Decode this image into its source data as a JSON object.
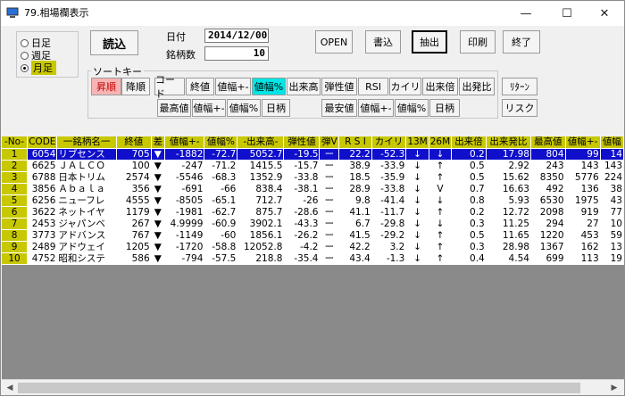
{
  "window": {
    "title": "79.相場欄表示",
    "minimize_glyph": "—",
    "maximize_glyph": "☐",
    "close_glyph": "✕"
  },
  "period": {
    "options": [
      "日足",
      "週足",
      "月足"
    ],
    "selected": "月足"
  },
  "buttons": {
    "load": "読込",
    "open": "OPEN",
    "write": "書込",
    "extract": "抽出",
    "print": "印刷",
    "exit": "終了"
  },
  "info": {
    "date_label": "日付",
    "date_value": "2014/12/00",
    "count_label": "銘柄数",
    "count_value": "10"
  },
  "sort": {
    "title": "ソートキー",
    "row1": [
      "昇順",
      "降順",
      "コード",
      "終値",
      "値幅+-",
      "値幅%",
      "出来高",
      "弾性値",
      "RSI",
      "カイリ",
      "出来倍",
      "出発比",
      "ﾘﾀｰﾝ"
    ],
    "row2": [
      "最高値",
      "値幅+-",
      "値幅%",
      "日柄",
      "最安値",
      "値幅+-",
      "値幅%",
      "日柄",
      "リスク"
    ]
  },
  "table": {
    "headers": [
      "-No-",
      "CODE",
      "一銘柄名一",
      "終値",
      "差",
      "値幅+-",
      "値幅%",
      "-出来高-",
      "弾性値",
      "弾V",
      "R S I",
      "カイリ",
      "13M",
      "26M",
      "出来倍",
      "出来発比",
      "最高値",
      "値幅+-",
      "値幅"
    ],
    "rows": [
      [
        "1",
        "6054",
        "リブセンス",
        "705",
        "▼",
        "-1882",
        "-72.7",
        "5052.7",
        "-19.5",
        "ー",
        "22.2",
        "-52.3",
        "↓",
        "↓",
        "0.2",
        "17.98",
        "804",
        "99",
        "14"
      ],
      [
        "2",
        "6625",
        "ＪＡＬＣＯ",
        "100",
        "▼",
        "-247",
        "-71.2",
        "1415.5",
        "-15.7",
        "ー",
        "38.9",
        "-33.9",
        "↓",
        "↑",
        "0.5",
        "2.92",
        "243",
        "143",
        "143"
      ],
      [
        "3",
        "6788",
        "日本トリム",
        "2574",
        "▼",
        "-5546",
        "-68.3",
        "1352.9",
        "-33.8",
        "ー",
        "18.5",
        "-35.9",
        "↓",
        "↑",
        "0.5",
        "15.62",
        "8350",
        "5776",
        "224"
      ],
      [
        "4",
        "3856",
        "Ａｂａｌａ",
        "356",
        "▼",
        "-691",
        "-66",
        "838.4",
        "-38.1",
        "ー",
        "28.9",
        "-33.8",
        "↓",
        "V",
        "0.7",
        "16.63",
        "492",
        "136",
        "38"
      ],
      [
        "5",
        "6256",
        "ニューフレ",
        "4555",
        "▼",
        "-8505",
        "-65.1",
        "712.7",
        "-26",
        "ー",
        "9.8",
        "-41.4",
        "↓",
        "↓",
        "0.8",
        "5.93",
        "6530",
        "1975",
        "43"
      ],
      [
        "6",
        "3622",
        "ネットイヤ",
        "1179",
        "▼",
        "-1981",
        "-62.7",
        "875.7",
        "-28.6",
        "ー",
        "41.1",
        "-11.7",
        "↓",
        "↑",
        "0.2",
        "12.72",
        "2098",
        "919",
        "77"
      ],
      [
        "7",
        "2453",
        "ジャパンベ",
        "267",
        "▼",
        "4.9999",
        "-60.9",
        "3902.1",
        "-43.3",
        "ー",
        "6.7",
        "-29.8",
        "↓",
        "↓",
        "0.3",
        "11.25",
        "294",
        "27",
        "10"
      ],
      [
        "8",
        "3773",
        "アドバンス",
        "767",
        "▼",
        "-1149",
        "-60",
        "1856.1",
        "-26.2",
        "ー",
        "41.5",
        "-29.2",
        "↓",
        "↑",
        "0.5",
        "11.65",
        "1220",
        "453",
        "59"
      ],
      [
        "9",
        "2489",
        "アドウェイ",
        "1205",
        "▼",
        "-1720",
        "-58.8",
        "12052.8",
        "-4.2",
        "ー",
        "42.2",
        "3.2",
        "↓",
        "↑",
        "0.3",
        "28.98",
        "1367",
        "162",
        "13"
      ],
      [
        "10",
        "4752",
        "昭和システ",
        "586",
        "▼",
        "-794",
        "-57.5",
        "218.8",
        "-35.4",
        "ー",
        "43.4",
        "-1.3",
        "↓",
        "↑",
        "0.4",
        "4.54",
        "699",
        "113",
        "19"
      ]
    ]
  },
  "scroll": {
    "left_glyph": "◀",
    "right_glyph": "▶"
  }
}
